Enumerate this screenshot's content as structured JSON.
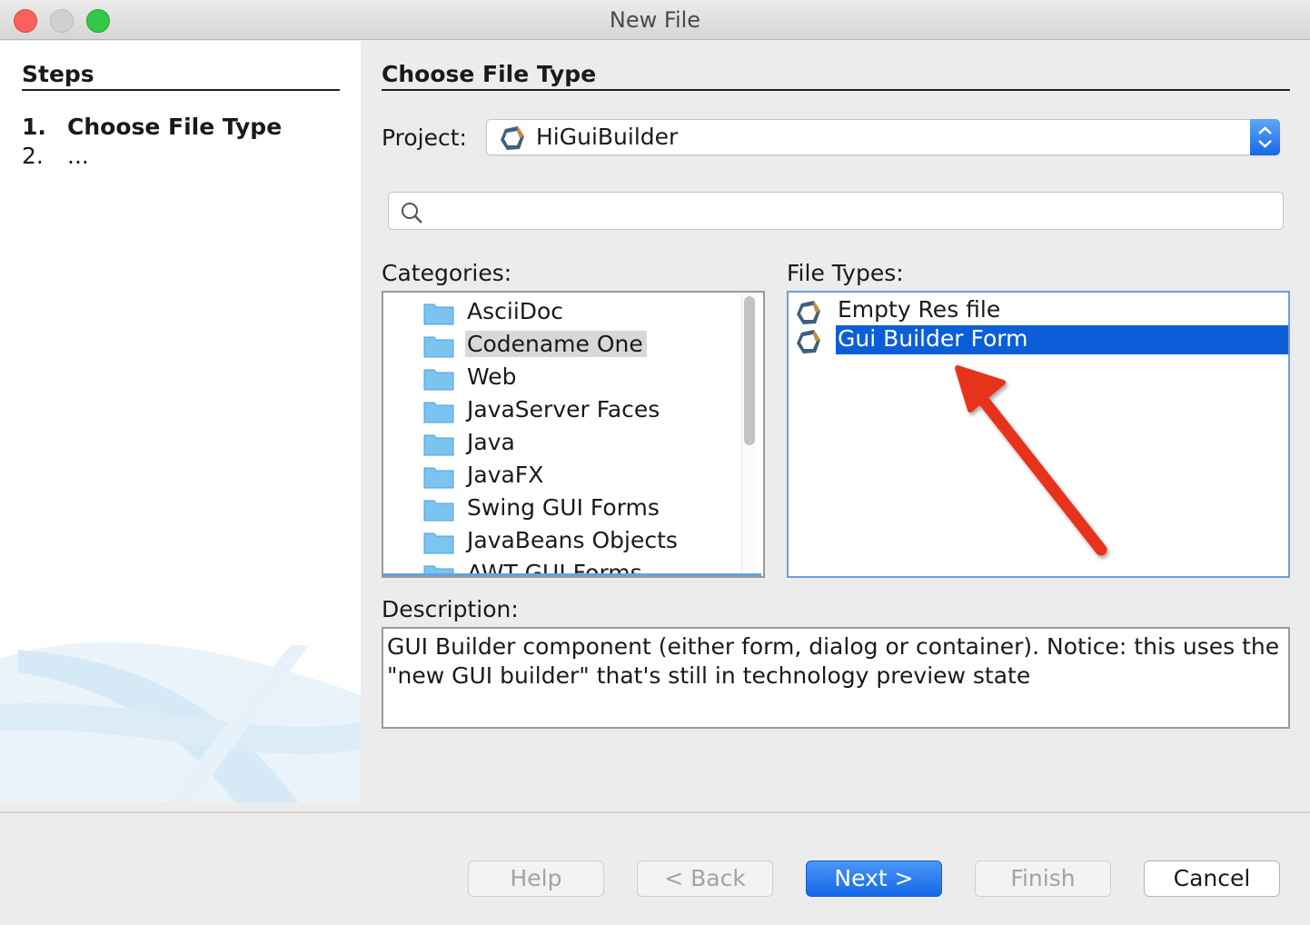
{
  "window": {
    "title": "New File"
  },
  "steps": {
    "title": "Steps",
    "items": [
      {
        "num": "1.",
        "label": "Choose File Type"
      },
      {
        "num": "2.",
        "label": "..."
      }
    ]
  },
  "main": {
    "title": "Choose File Type",
    "project_label": "Project:",
    "project_value": "HiGuiBuilder",
    "search_placeholder": "",
    "categories_label": "Categories:",
    "categories": [
      "AsciiDoc",
      "Codename One",
      "Web",
      "JavaServer Faces",
      "Java",
      "JavaFX",
      "Swing GUI Forms",
      "JavaBeans Objects",
      "AWT GUI Forms"
    ],
    "selected_category": "Codename One",
    "file_types_label": "File Types:",
    "file_types": [
      "Empty Res file",
      "Gui Builder Form"
    ],
    "selected_file_type": "Gui Builder Form",
    "description_label": "Description:",
    "description_line1": "GUI Builder component (either form, dialog or container). Notice: this uses the",
    "description_line2": "\"new GUI builder\" that's still in technology preview state"
  },
  "buttons": {
    "help": "Help",
    "back": "< Back",
    "next": "Next >",
    "finish": "Finish",
    "cancel": "Cancel"
  },
  "colors": {
    "selection": "#0b5ed8",
    "primary_button": "#1468e6",
    "annotation_arrow": "#e8321e"
  }
}
